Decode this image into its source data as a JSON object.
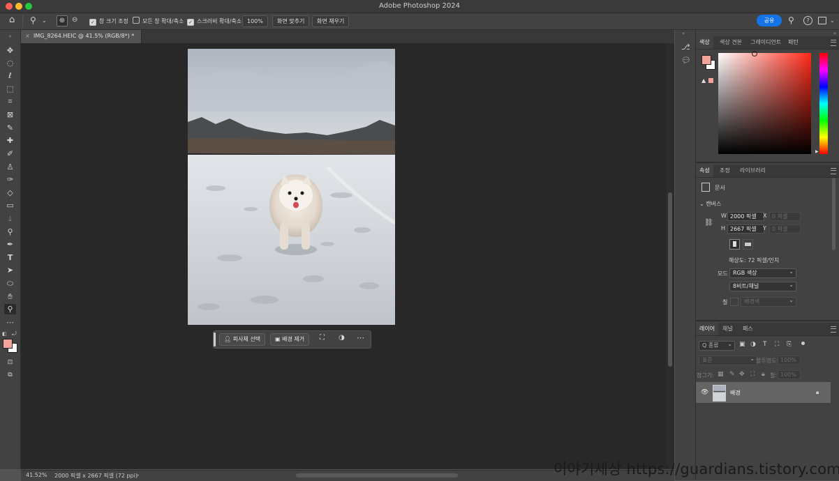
{
  "app": {
    "title": "Adobe Photoshop 2024"
  },
  "options_bar": {
    "resize_windows": "창 크기 조정",
    "zoom_all_windows": "모든 창 확대/축소",
    "scrubby_zoom": "스크러비 확대/축소",
    "zoom_value": "100%",
    "fit_screen": "화면 맞추기",
    "fill_screen": "화면 채우기",
    "share": "공유"
  },
  "document": {
    "tab_label": "IMG_8264.HEIC @ 41.5% (RGB/8*) *",
    "close_glyph": "×"
  },
  "task_bar": {
    "select_subject": "피사체 선택",
    "remove_background": "배경 제거",
    "more": "⋯"
  },
  "status_bar": {
    "zoom": "41.52%",
    "info": "2000 픽셀 x 2667 픽셀 (72 ppi)",
    "arrow": "›"
  },
  "color_panel": {
    "tabs": [
      "색상",
      "색상 견본",
      "그레이디언트",
      "패턴"
    ],
    "foreground": "#f4a49a",
    "background": "#ffffff",
    "hue": "#ff2a18"
  },
  "properties_panel": {
    "tabs": [
      "속성",
      "조정",
      "라이브러리"
    ],
    "doc_label": "문서",
    "canvas_section": "캔버스",
    "w_label": "W",
    "w_value": "2000 픽셀",
    "h_label": "H",
    "h_value": "2667 픽셀",
    "x_label": "X",
    "x_placeholder": "0 픽셀",
    "y_label": "Y",
    "y_placeholder": "0 픽셀",
    "resolution": "해상도: 72 픽셀/인치",
    "mode_label": "모드",
    "mode_value": "RGB 색상",
    "depth_value": "8비트/채널",
    "fill_label": "칠",
    "fill_value": "배경색"
  },
  "layers_panel": {
    "tabs": [
      "레이어",
      "채널",
      "패스"
    ],
    "filter_kind": "Q 종류",
    "blend_mode": "표준",
    "opacity_label": "불투명도:",
    "opacity_value": "100%",
    "lock_label": "잠그기:",
    "fill_label": "칠:",
    "fill_value": "100%",
    "layers": [
      {
        "name": "배경"
      }
    ]
  },
  "watermark": "이야기세상 https://guardians.tistory.com"
}
